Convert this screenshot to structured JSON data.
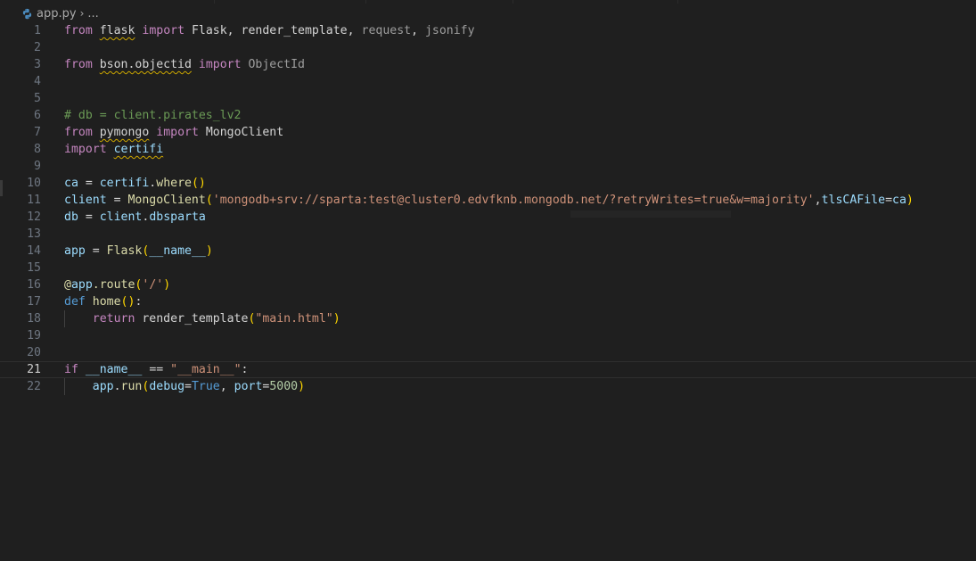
{
  "breadcrumb": {
    "file": "app.py",
    "separator": "›",
    "more": "..."
  },
  "colors": {
    "background": "#1f1f1f",
    "keyword": "#c586c0",
    "control": "#569cd6",
    "variable": "#9cdcfe",
    "function": "#dcdcaa",
    "string": "#ce9178",
    "number": "#b5cea8",
    "comment": "#6a9955"
  },
  "current_line": 21,
  "lines": [
    {
      "n": "1",
      "tokens": [
        [
          "kw",
          "from"
        ],
        [
          "id",
          " "
        ],
        [
          "id wavy",
          "flask"
        ],
        [
          "id",
          " "
        ],
        [
          "kw",
          "import"
        ],
        [
          "id",
          " Flask, render_template, "
        ],
        [
          "dim",
          "request"
        ],
        [
          "id",
          ", "
        ],
        [
          "dim",
          "jsonify"
        ]
      ]
    },
    {
      "n": "2",
      "tokens": []
    },
    {
      "n": "3",
      "tokens": [
        [
          "kw",
          "from"
        ],
        [
          "id",
          " "
        ],
        [
          "id wavy",
          "bson.objectid"
        ],
        [
          "id",
          " "
        ],
        [
          "kw",
          "import"
        ],
        [
          "id",
          " "
        ],
        [
          "dim",
          "ObjectId"
        ]
      ]
    },
    {
      "n": "4",
      "tokens": []
    },
    {
      "n": "5",
      "tokens": []
    },
    {
      "n": "6",
      "tokens": [
        [
          "com",
          "# db = client.pirates_lv2"
        ]
      ]
    },
    {
      "n": "7",
      "tokens": [
        [
          "kw",
          "from"
        ],
        [
          "id",
          " "
        ],
        [
          "id wavy",
          "pymongo"
        ],
        [
          "id",
          " "
        ],
        [
          "kw",
          "import"
        ],
        [
          "id",
          " MongoClient"
        ]
      ]
    },
    {
      "n": "8",
      "tokens": [
        [
          "kw",
          "import"
        ],
        [
          "id",
          " "
        ],
        [
          "var wavy",
          "certifi"
        ]
      ]
    },
    {
      "n": "9",
      "tokens": []
    },
    {
      "n": "10",
      "tokens": [
        [
          "var",
          "ca"
        ],
        [
          "id",
          " = "
        ],
        [
          "var",
          "certifi"
        ],
        [
          "id",
          "."
        ],
        [
          "fn",
          "where"
        ],
        [
          "p1",
          "()"
        ]
      ]
    },
    {
      "n": "11",
      "tokens": [
        [
          "var",
          "client"
        ],
        [
          "id",
          " = "
        ],
        [
          "fn",
          "MongoClient"
        ],
        [
          "p1",
          "("
        ],
        [
          "str",
          "'mongodb+srv://sparta:test@cluster0.edvfknb.mongodb.net/?retryWrites=true&w=majority'"
        ],
        [
          "id",
          ","
        ],
        [
          "var",
          "tlsCAFile"
        ],
        [
          "id",
          "="
        ],
        [
          "var",
          "ca"
        ],
        [
          "p1",
          ")"
        ]
      ]
    },
    {
      "n": "12",
      "tokens": [
        [
          "var",
          "db"
        ],
        [
          "id",
          " = "
        ],
        [
          "var",
          "client"
        ],
        [
          "id",
          "."
        ],
        [
          "var",
          "dbsparta"
        ]
      ]
    },
    {
      "n": "13",
      "tokens": []
    },
    {
      "n": "14",
      "tokens": [
        [
          "var",
          "app"
        ],
        [
          "id",
          " = "
        ],
        [
          "fn",
          "Flask"
        ],
        [
          "p1",
          "("
        ],
        [
          "var",
          "__name__"
        ],
        [
          "p1",
          ")"
        ]
      ]
    },
    {
      "n": "15",
      "tokens": []
    },
    {
      "n": "16",
      "tokens": [
        [
          "fn",
          "@"
        ],
        [
          "var",
          "app"
        ],
        [
          "fn",
          ".route"
        ],
        [
          "p1",
          "("
        ],
        [
          "str",
          "'/'"
        ],
        [
          "p1",
          ")"
        ]
      ]
    },
    {
      "n": "17",
      "tokens": [
        [
          "kwb",
          "def"
        ],
        [
          "id",
          " "
        ],
        [
          "fn",
          "home"
        ],
        [
          "p1",
          "()"
        ],
        [
          "id",
          ":"
        ]
      ]
    },
    {
      "n": "18",
      "tokens": [
        [
          "id",
          "    "
        ],
        [
          "kw",
          "return"
        ],
        [
          "id",
          " render_template"
        ],
        [
          "p1",
          "("
        ],
        [
          "str",
          "\"main.html\""
        ],
        [
          "p1",
          ")"
        ]
      ]
    },
    {
      "n": "19",
      "tokens": []
    },
    {
      "n": "20",
      "tokens": []
    },
    {
      "n": "21",
      "tokens": [
        [
          "kw",
          "if"
        ],
        [
          "id",
          " "
        ],
        [
          "var",
          "__name__"
        ],
        [
          "id",
          " == "
        ],
        [
          "str",
          "\"__main__\""
        ],
        [
          "id",
          ":"
        ]
      ]
    },
    {
      "n": "22",
      "tokens": [
        [
          "id",
          "    "
        ],
        [
          "var",
          "app"
        ],
        [
          "id",
          "."
        ],
        [
          "fn",
          "run"
        ],
        [
          "p1",
          "("
        ],
        [
          "var",
          "debug"
        ],
        [
          "id",
          "="
        ],
        [
          "kwb",
          "True"
        ],
        [
          "id",
          ", "
        ],
        [
          "var",
          "port"
        ],
        [
          "id",
          "="
        ],
        [
          "num",
          "5000"
        ],
        [
          "p1",
          ")"
        ]
      ]
    }
  ]
}
